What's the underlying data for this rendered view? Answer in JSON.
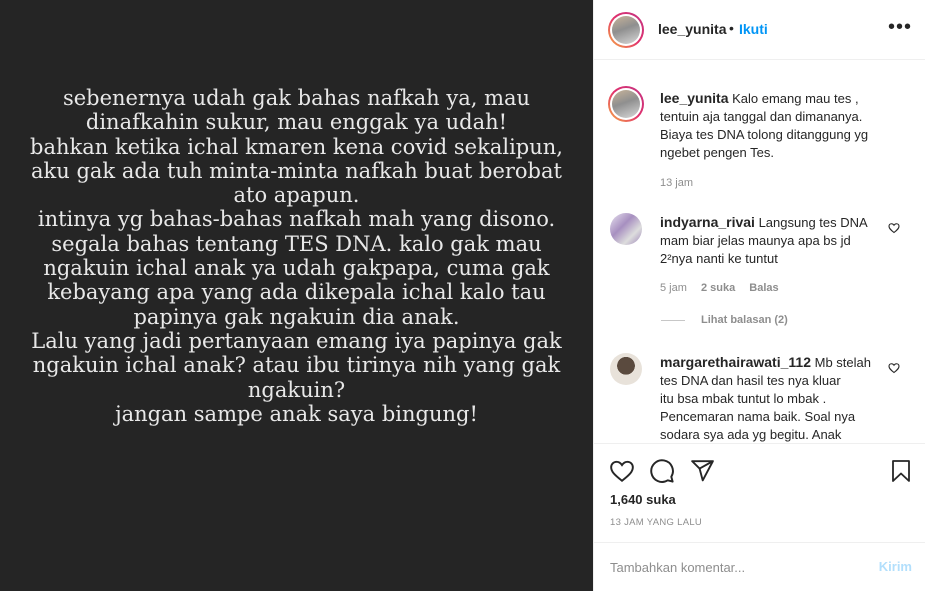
{
  "post_text": [
    "sebenernya udah gak bahas nafkah ya, mau",
    "dinafkahin sukur, mau enggak ya udah!",
    "bahkan ketika ichal kmaren kena covid sekalipun,",
    "aku gak ada tuh minta-minta nafkah buat berobat",
    "ato apapun.",
    "intinya yg bahas-bahas nafkah mah yang disono.",
    "segala bahas tentang TES DNA. kalo gak mau",
    "ngakuin ichal anak ya udah gakpapa,  cuma gak",
    "kebayang apa yang ada dikepala ichal kalo tau",
    "papinya gak ngakuin dia anak.",
    "Lalu yang jadi pertanyaan emang iya papinya gak",
    "ngakuin ichal anak? atau ibu tirinya nih yang gak",
    "ngakuin?",
    "jangan sampe anak saya bingung!"
  ],
  "header": {
    "username": "lee_yunita",
    "separator": "•",
    "follow_label": "Ikuti",
    "more_icon": "more-horizontal-icon"
  },
  "caption": {
    "username": "lee_yunita",
    "lines": [
      "Kalo emang mau tes ,",
      "tentuin aja tanggal dan dimananya.",
      "Biaya tes DNA tolong ditanggung yg",
      "ngebet pengen Tes."
    ],
    "time": "13 jam"
  },
  "comments": [
    {
      "username": "indyarna_rivai",
      "lines": [
        "Langsung tes DNA",
        "mam biar jelas maunya apa bs jd",
        "2²nya nanti ke tuntut"
      ],
      "time": "5 jam",
      "likes": "2 suka",
      "reply_label": "Balas",
      "view_replies": "Lihat balasan (2)"
    },
    {
      "username": "margarethairawati_112",
      "lines": [
        "Mb stelah",
        "tes DNA dan hasil tes nya kluar",
        "itu bsa mbak tuntut lo mbak .",
        "Pencemaran nama baik. Soal nya",
        "sodara sya ada yg begitu. Anak"
      ]
    }
  ],
  "actions": {
    "icons": [
      "heart-icon",
      "comment-icon",
      "share-icon",
      "bookmark-icon"
    ],
    "likes_count": "1,640 suka",
    "time_ago": "13 JAM YANG LALU"
  },
  "add_comment": {
    "placeholder": "Tambahkan komentar...",
    "post_label": "Kirim"
  },
  "colors": {
    "post_background": "#252525",
    "post_text": "#e8e8e8",
    "link_blue": "#0095f6",
    "post_button_disabled": "#b2dffc",
    "meta_gray": "#8e8e8e"
  }
}
